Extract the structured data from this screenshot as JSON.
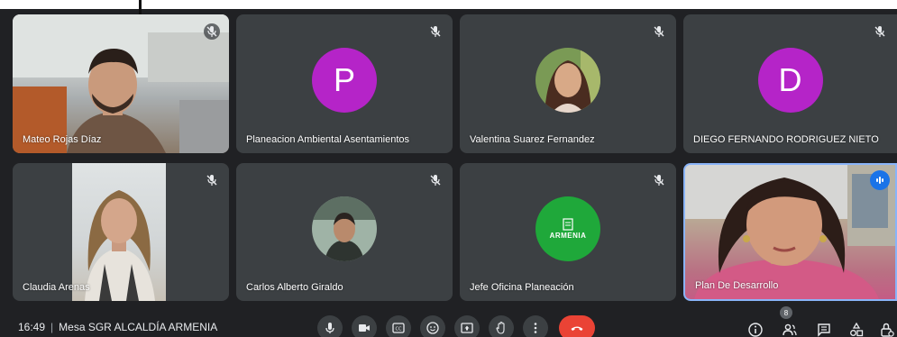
{
  "participants": [
    {
      "name": "Mateo Rojas Díaz",
      "type": "video"
    },
    {
      "name": "Planeacion Ambiental Asentamientos",
      "type": "letter",
      "initial": "P"
    },
    {
      "name": "Valentina Suarez Fernandez",
      "type": "photo"
    },
    {
      "name": "DIEGO FERNANDO RODRIGUEZ NIETO",
      "type": "letter",
      "initial": "D"
    },
    {
      "name": "Claudia Arenas",
      "type": "video"
    },
    {
      "name": "Carlos Alberto Giraldo",
      "type": "photo"
    },
    {
      "name": "Jefe Oficina Planeación",
      "type": "logo",
      "logo_text": "ARMENIA"
    },
    {
      "name": "Plan De Desarrollo",
      "type": "video",
      "speaking": true
    }
  ],
  "meeting": {
    "time": "16:49",
    "separator": "|",
    "title": "Mesa SGR ALCALDÍA ARMENIA"
  },
  "participant_count": "8",
  "colors": {
    "letter_avatar": "#b524c8",
    "end_call": "#ea4335",
    "active_speaker": "#1a73e8",
    "logo_green": "#1fa83a"
  },
  "icons": {
    "tile_status": "mic-off-icon",
    "controls": [
      "mic-icon",
      "camera-icon",
      "captions-icon",
      "emoji-icon",
      "present-icon",
      "raise-hand-icon",
      "more-options-icon",
      "end-call-icon"
    ],
    "right": [
      "info-icon",
      "people-icon",
      "chat-icon",
      "activities-icon",
      "host-controls-icon"
    ]
  }
}
